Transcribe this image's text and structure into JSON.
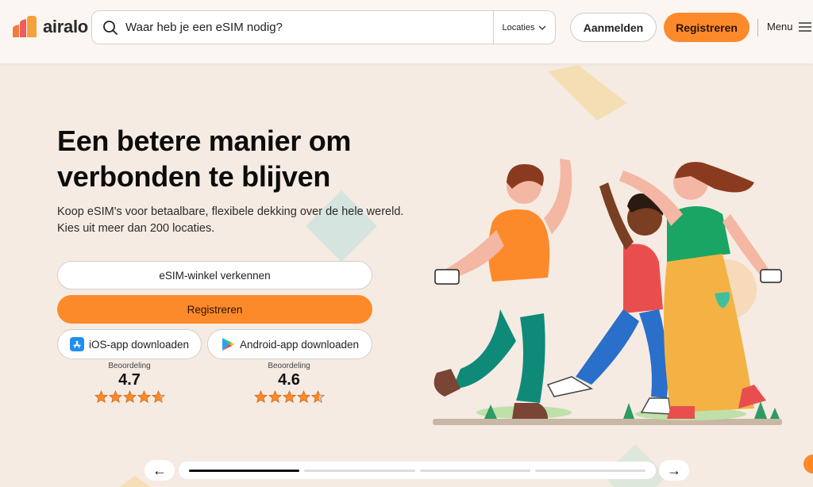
{
  "brand": {
    "name": "airalo"
  },
  "header": {
    "search_placeholder": "Waar heb je een eSIM nodig?",
    "locations_label": "Locaties",
    "login_label": "Aanmelden",
    "register_label": "Registreren",
    "menu_label": "Menu"
  },
  "hero": {
    "title": "Een betere manier om verbonden te blijven",
    "subtitle": "Koop eSIM's voor betaalbare, flexibele dekking over de hele wereld. Kies uit meer dan 200 locaties.",
    "explore_button": "eSIM-winkel verkennen",
    "register_button": "Registreren",
    "ios_button": "iOS-app downloaden",
    "android_button": "Android-app downloaden"
  },
  "ratings": [
    {
      "label": "Beoordeling",
      "value": "4.7",
      "stars": 4.7
    },
    {
      "label": "Beoordeling",
      "value": "4.6",
      "stars": 4.6
    }
  ],
  "carousel": {
    "prev": "←",
    "next": "→",
    "segments": 4,
    "active_index": 0
  },
  "colors": {
    "accent": "#fd8a2a",
    "background": "#f5ebe3",
    "header": "#fbf6f2"
  }
}
